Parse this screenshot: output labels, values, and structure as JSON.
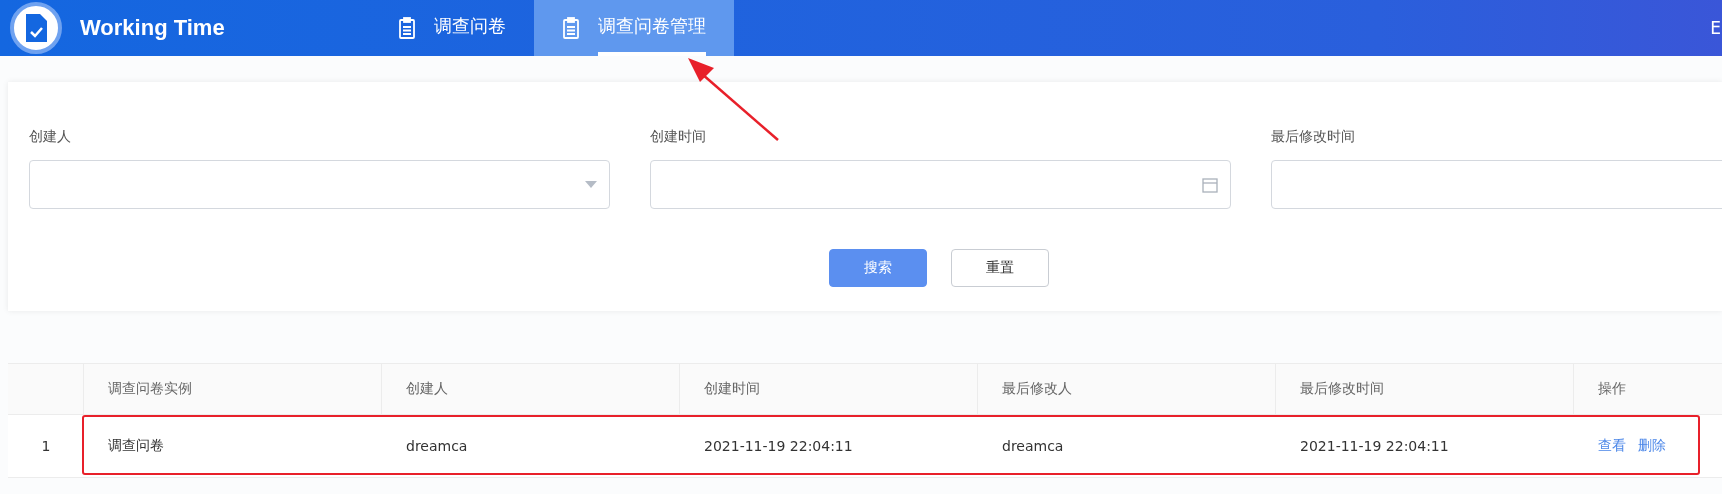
{
  "header": {
    "title": "Working Time",
    "tabs": [
      {
        "label": "调查问卷",
        "selected": false
      },
      {
        "label": "调查问卷管理",
        "selected": true
      }
    ],
    "user": "E"
  },
  "filters": [
    {
      "label": "创建人",
      "kind": "select"
    },
    {
      "label": "创建时间",
      "kind": "date"
    },
    {
      "label": "最后修改时间",
      "kind": "text"
    }
  ],
  "buttons": [
    {
      "label": "搜索",
      "kind": "primary"
    },
    {
      "label": "重置",
      "kind": "default"
    }
  ],
  "table": {
    "columns": [
      "",
      "调查问卷实例",
      "创建人",
      "创建时间",
      "最后修改人",
      "最后修改时间",
      "操作"
    ],
    "rows": [
      {
        "cells": [
          "1",
          "调查问卷",
          "dreamca",
          "2021-11-19 22:04:11",
          "dreamca",
          "2021-11-19 22:04:11"
        ],
        "actions": [
          "查看",
          "删除"
        ],
        "highlighted": true
      }
    ]
  }
}
